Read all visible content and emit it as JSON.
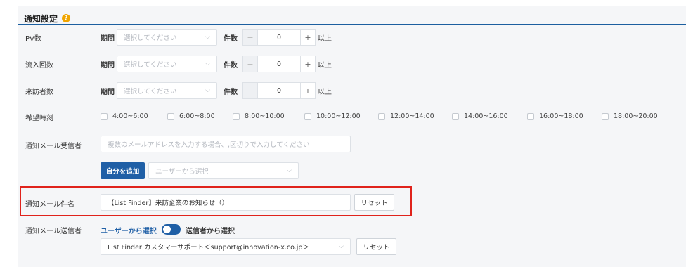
{
  "section": {
    "title": "通知設定"
  },
  "period_label": "期間",
  "count_label": "件数",
  "select_placeholder": "選択してください",
  "suffix": "以上",
  "minus": "−",
  "plus": "+",
  "rows": {
    "pv": {
      "label": "PV数",
      "count": "0"
    },
    "inflow": {
      "label": "流入回数",
      "count": "0"
    },
    "visitors": {
      "label": "来訪者数",
      "count": "0"
    }
  },
  "time": {
    "label": "希望時刻",
    "options": [
      "4:00~6:00",
      "6:00~8:00",
      "8:00~10:00",
      "10:00~12:00",
      "12:00~14:00",
      "14:00~16:00",
      "16:00~18:00",
      "18:00~20:00"
    ]
  },
  "recipients": {
    "label": "通知メール受信者",
    "placeholder": "複数のメールアドレスを入力する場合、,区切りで入力してください",
    "add_self": "自分を追加",
    "user_select_placeholder": "ユーザーから選択"
  },
  "subject": {
    "label": "通知メール件名",
    "value": "【List Finder】来訪企業のお知らせ（）",
    "reset": "リセット"
  },
  "sender": {
    "label": "通知メール送信者",
    "from_users": "ユーザーから選択",
    "from_senders": "送信者から選択",
    "selected": "List Finder カスタマーサポート＜support@innovation-x.co.jp＞",
    "reset": "リセット"
  },
  "colors": {
    "accent": "#1f5fa6",
    "help": "#f0a500",
    "highlight": "#e0231c"
  },
  "icons": {
    "help": "help-icon",
    "chevron": "chevron-down-icon"
  }
}
